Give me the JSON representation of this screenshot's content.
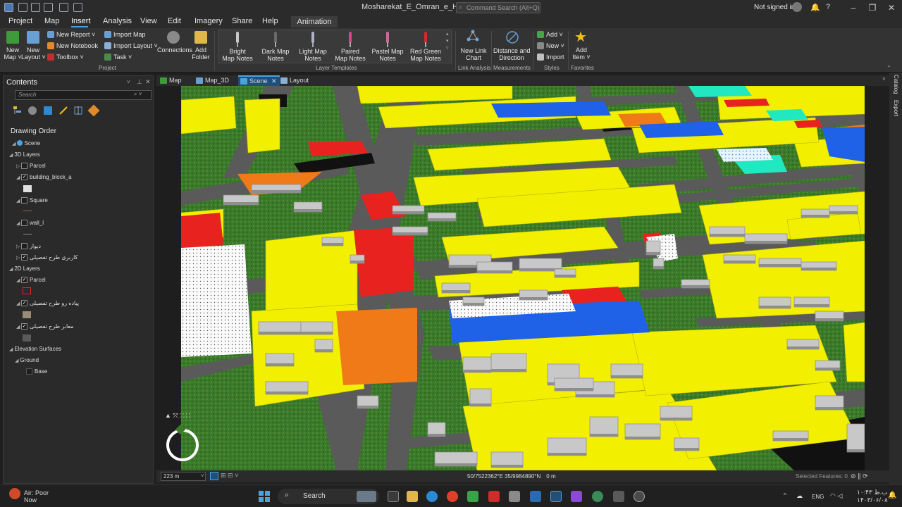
{
  "window": {
    "title": "Mosharekat_E_Omran_e_Hashtgerd",
    "command_search_placeholder": "Command Search (Alt+Q)",
    "signin": "Not signed in",
    "controls": [
      "minimize",
      "restore",
      "close"
    ]
  },
  "ribbon": {
    "tabs": [
      "Project",
      "Map",
      "Insert",
      "Analysis",
      "View",
      "Edit",
      "Imagery",
      "Share",
      "Help"
    ],
    "active_tab": "Insert",
    "context_tab": "Animation",
    "project_group": {
      "label": "Project",
      "new_map": "New Map",
      "new_map_line1": "New",
      "new_map_line2": "Map ˅",
      "new_layout_line1": "New",
      "new_layout_line2": "Layout ˅",
      "new_report": "New Report",
      "new_notebook": "New Notebook",
      "toolbox": "Toolbox",
      "import_map": "Import Map",
      "import_layout": "Import Layout",
      "task": "Task",
      "connections": "Connections",
      "add_folder_line1": "Add",
      "add_folder_line2": "Folder"
    },
    "layer_templates": {
      "label": "Layer Templates",
      "items": [
        {
          "line1": "Bright",
          "line2": "Map Notes",
          "color": "#c8c8c8"
        },
        {
          "line1": "Dark Map",
          "line2": "Notes",
          "color": "#6a6a6a"
        },
        {
          "line1": "Light Map",
          "line2": "Notes",
          "color": "#b0b0c8"
        },
        {
          "line1": "Paired",
          "line2": "Map Notes",
          "color": "#d04a8a"
        },
        {
          "line1": "Pastel Map",
          "line2": "Notes",
          "color": "#c86a9a"
        },
        {
          "line1": "Red Green",
          "line2": "Map Notes",
          "color": "#d02a2a"
        }
      ]
    },
    "link_analysis": {
      "label": "Link Analysis",
      "line1": "New Link",
      "line2": "Chart"
    },
    "measurements": {
      "label": "Measurements",
      "line1": "Distance and",
      "line2": "Direction"
    },
    "styles": {
      "label": "Styles",
      "add": "Add",
      "new": "New",
      "import": "Import"
    },
    "favorites": {
      "label": "Favorites",
      "line1": "Add",
      "line2": "Item ˅"
    }
  },
  "contents": {
    "title": "Contents",
    "search_placeholder": "Search",
    "drawing_order": "Drawing Order",
    "tree": [
      {
        "label": "Scene",
        "level": 0
      },
      {
        "label": "3D Layers",
        "level": 0
      },
      {
        "label": "Parcel",
        "level": 1,
        "checked": false
      },
      {
        "label": "building_block_a",
        "level": 1,
        "checked": true
      },
      {
        "label": "Square",
        "level": 1,
        "checked": false
      },
      {
        "label": "wall_l",
        "level": 1,
        "checked": false
      },
      {
        "label": "دیوار",
        "level": 1,
        "checked": false
      },
      {
        "label": "کاربری طرح تفصیلی",
        "level": 1,
        "checked": true
      },
      {
        "label": "2D Layers",
        "level": 0
      },
      {
        "label": "Parcel",
        "level": 1,
        "checked": true
      },
      {
        "label": "پیاده رو طرح تفصیلی",
        "level": 1,
        "checked": true
      },
      {
        "label": "معابر طرح تفصیلی",
        "level": 1,
        "checked": true
      },
      {
        "label": "Elevation Surfaces",
        "level": 0
      },
      {
        "label": "Ground",
        "level": 1
      },
      {
        "label": "Base",
        "level": 2
      }
    ]
  },
  "view_tabs": [
    {
      "label": "Map",
      "active": false
    },
    {
      "label": "Map_3D",
      "active": false
    },
    {
      "label": "Scene",
      "active": true
    },
    {
      "label": "Layout",
      "active": false
    }
  ],
  "status": {
    "scale": "223 m",
    "coords": "50/7522362°E 35/9984890°N",
    "elevation": "0 m",
    "selected_features": "Selected Features: 0"
  },
  "right_pane": [
    "Catalog",
    "Export"
  ],
  "taskbar": {
    "weather_line1": "Air: Poor",
    "weather_line2": "Now",
    "search": "Search",
    "lang": "ENG",
    "time": "۱۰:۴۳ ب.ظ",
    "date": "۱۴۰۳/۰۶/۰۸"
  },
  "colors": {
    "accent": "#4aa3df",
    "grass": "#3b7a2a",
    "road": "#5a5a5a",
    "residential": "#f2f000",
    "commercial": "#e8231f",
    "education": "#1f62e8",
    "industrial": "#f07a17",
    "sport": "#20e8c0"
  }
}
